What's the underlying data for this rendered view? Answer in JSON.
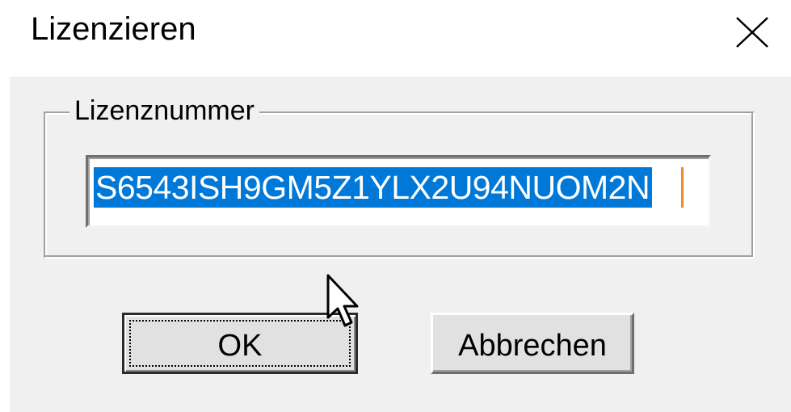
{
  "window": {
    "title": "Lizenzieren",
    "close_icon": "close-icon"
  },
  "group": {
    "label": "Lizenznummer"
  },
  "license_field": {
    "value": "S6543ISH9GM5Z1YLX2U94NUOM2N",
    "selected": true,
    "selection_color": "#0078d7"
  },
  "buttons": {
    "ok_label": "OK",
    "cancel_label": "Abbrechen"
  },
  "cursor": {
    "icon": "mouse-pointer-icon"
  }
}
